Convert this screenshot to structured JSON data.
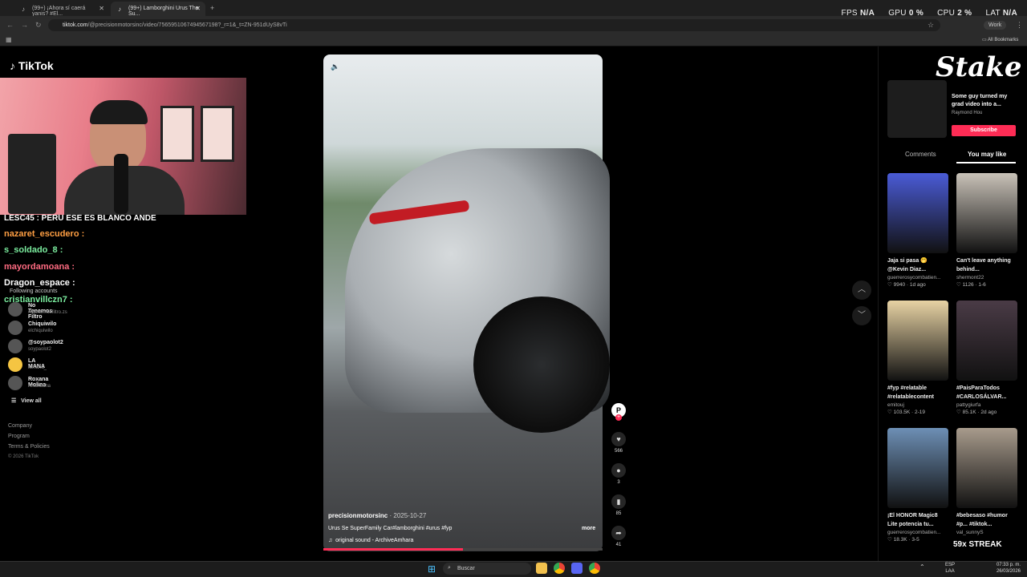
{
  "browser": {
    "tabs": [
      {
        "label": "(99+) ¡Ahora sí caerá yanis? #El..."
      },
      {
        "label": "(99+) Lamborghini Urus The Su..."
      }
    ],
    "url_host": "tiktok.com",
    "url_path": "/@precisionmotorsinc/video/7565951067494567198?_r=1&_t=ZN-951dUyS8vTi",
    "profile_label": "Work",
    "bookmarks_label": "All Bookmarks"
  },
  "overlay_stats": {
    "fps_label": "FPS",
    "fps": "N/A",
    "gpu_label": "GPU",
    "gpu": "0 %",
    "cpu_label": "CPU",
    "cpu": "2 %",
    "lat_label": "LAT",
    "lat": "N/A"
  },
  "tiktok": {
    "logo": "TikTok"
  },
  "chat": [
    {
      "user": "LESC45 : PERU ESE ES BLANCO ANDE",
      "color": "#ffffff"
    },
    {
      "user": "nazaret_escudero :",
      "color": "#ff9f43"
    },
    {
      "user": "s_soldado_8 :",
      "color": "#7bed9f"
    },
    {
      "user": "mayordamoana :",
      "color": "#ff6b81"
    },
    {
      "user": "Dragon_espace :",
      "color": "#ffffff"
    },
    {
      "user": "cristianvillczn7 :",
      "color": "#7bed9f"
    }
  ],
  "sidebar": {
    "following_heading": "Following accounts",
    "accounts": [
      {
        "name": "No Tenemos Filtro",
        "handle": "notenemosfiltro.zs"
      },
      {
        "name": "Chiquiwilo",
        "handle": "elchiquiwilo"
      },
      {
        "name": "@soypaolot2",
        "handle": "soypaolot2"
      },
      {
        "name": "LA MANA",
        "handle": "lamana_"
      },
      {
        "name": "Roxana Molina",
        "handle": "roxanacha"
      }
    ],
    "view_all": "View all",
    "footer": [
      "Company",
      "Program",
      "Terms & Policies"
    ],
    "copyright": "© 2026 TikTok"
  },
  "video": {
    "author": "precisionmotorsinc",
    "date": "· 2025-10-27",
    "caption": "Urus Se SuperFamily Car#lamborghini #urus #fyp",
    "more": "more",
    "sound": "original sound - ArchiveAmhara",
    "likes": "566",
    "comments": "3",
    "saves": "85",
    "shares": "41",
    "progress": 0.5
  },
  "right_panel": {
    "ad_title": "Some guy turned my grad video into a...",
    "ad_author": "Raymond Hou",
    "subscribe": "Subscribe",
    "stake_logo": "Stake",
    "tabs": [
      "Comments",
      "You may like"
    ],
    "cards": [
      {
        "title": "Jaja si pasa 🤭 @Kevin Diaz...",
        "author": "guerrerosycombatien...",
        "stats": "♡ 9940 · 1d ago",
        "color": "#4a5bd6"
      },
      {
        "title": "Can't leave anything behind...",
        "author": "shermont22",
        "stats": "♡ 1126 · 1-6",
        "color": "#c9c2b8"
      },
      {
        "title": "#fyp #relatable #relatablecontent",
        "author": "emitouj",
        "stats": "♡ 103.5K · 2-19",
        "color": "#e8d3a4"
      },
      {
        "title": "#PaisParaTodos #CARLOSÁLVAR...",
        "author": "pattygiurfa",
        "stats": "♡ 85.1K · 2d ago",
        "color": "#4a3b46"
      },
      {
        "title": "¡El HONOR Magic8 Lite potencia tu...",
        "author": "guerrerosycombatien...",
        "stats": "♡ 18.3K · 3-5",
        "color": "#6d8fb5"
      },
      {
        "title": "#bebesaso #humor #p... #tiktok...",
        "author": "val_sunnyS",
        "stats": "",
        "color": "#a89b8c"
      }
    ],
    "streak": "59x STREAK"
  },
  "taskbar": {
    "search_placeholder": "Buscar",
    "lang": "ESP",
    "lang2": "LAA",
    "time": "07:33 p. m.",
    "date": "26/03/2026"
  }
}
